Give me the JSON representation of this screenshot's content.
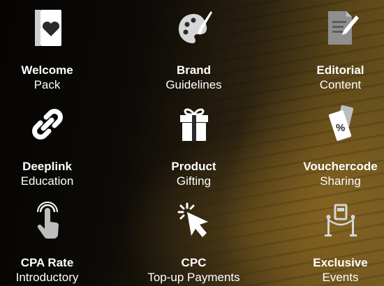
{
  "benefits": [
    {
      "title": "Welcome",
      "subtitle": "Pack",
      "icon": "heart-book-icon"
    },
    {
      "title": "Brand",
      "subtitle": "Guidelines",
      "icon": "palette-icon"
    },
    {
      "title": "Editorial",
      "subtitle": "Content",
      "icon": "pen-document-icon"
    },
    {
      "title": "Deeplink",
      "subtitle": "Education",
      "icon": "link-icon"
    },
    {
      "title": "Product",
      "subtitle": "Gifting",
      "icon": "gift-icon"
    },
    {
      "title": "Vouchercode",
      "subtitle": "Sharing",
      "icon": "voucher-icon"
    },
    {
      "title": "CPA Rate",
      "subtitle": "Introductory",
      "icon": "tap-hand-icon"
    },
    {
      "title": "CPC",
      "subtitle": "Top-up Payments",
      "icon": "cursor-click-icon"
    },
    {
      "title": "Exclusive",
      "subtitle": "Events",
      "icon": "velvet-rope-icon"
    }
  ]
}
